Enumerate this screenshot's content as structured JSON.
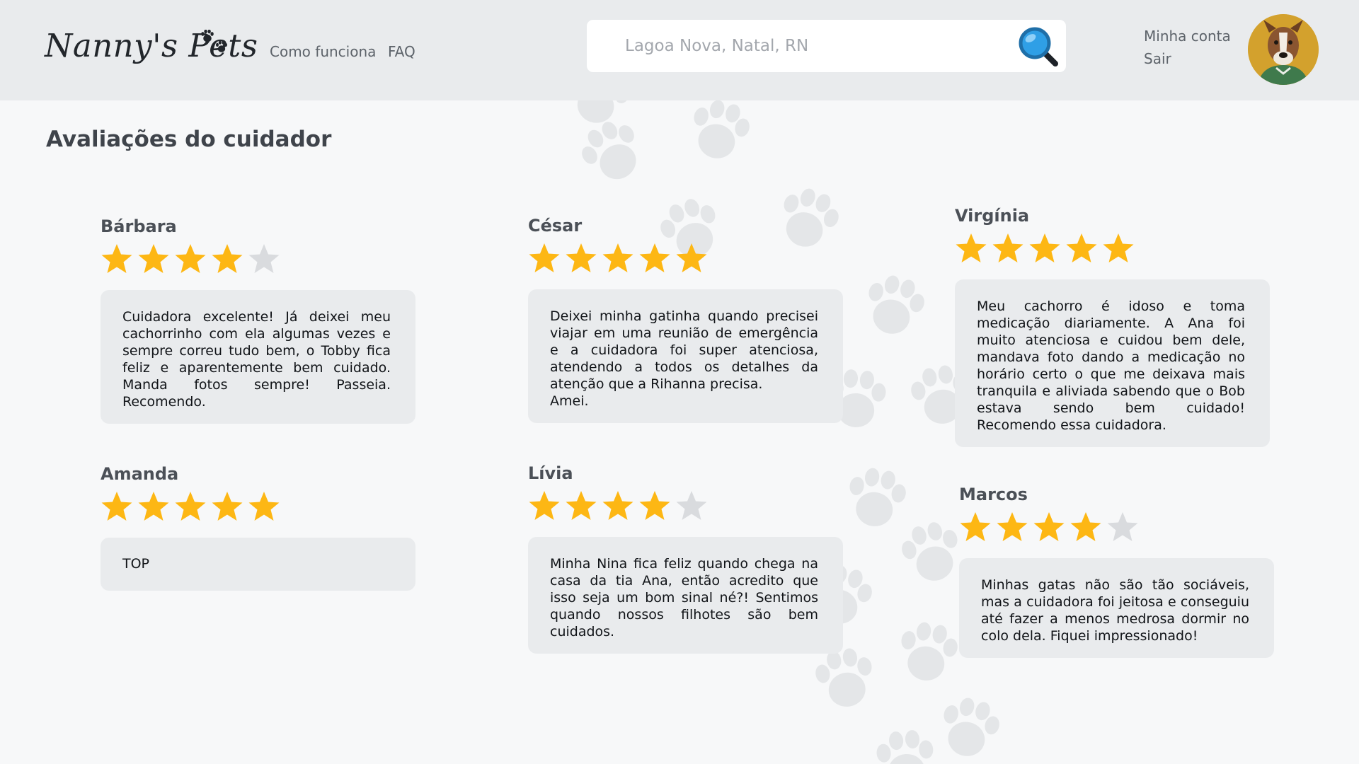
{
  "header": {
    "logo_text": "Nanny's Pets",
    "nav": {
      "how_it_works": "Como funciona",
      "faq": "FAQ"
    },
    "search": {
      "placeholder": "Lagoa Nova, Natal, RN",
      "icon": "magnifier-icon"
    },
    "account": {
      "my_account": "Minha conta",
      "logout": "Sair"
    }
  },
  "main": {
    "title": "Avaliações do cuidador",
    "reviews": [
      {
        "name": "Bárbara",
        "rating": 4,
        "text": "Cuidadora excelente! Já deixei meu cachorrinho com ela algumas vezes e sempre correu tudo bem, o Tobby fica feliz e aparentemente bem cuidado. Manda fotos sempre! Passeia. Recomendo."
      },
      {
        "name": "César",
        "rating": 5,
        "text": "Deixei minha gatinha quando precisei viajar em uma reunião de emergência e a cuidadora foi super atenciosa, atendendo a todos os detalhes da atenção que a Rihanna precisa.\nAmei."
      },
      {
        "name": "Virgínia",
        "rating": 5,
        "text": "Meu cachorro é idoso e toma medicação diariamente. A Ana foi muito atenciosa e cuidou bem dele, mandava foto dando a medicação no horário certo o que me deixava mais tranquila e aliviada sabendo que o Bob estava sendo bem cuidado! Recomendo essa cuidadora."
      },
      {
        "name": "Amanda",
        "rating": 5,
        "text": "TOP"
      },
      {
        "name": "Lívia",
        "rating": 4,
        "text": "Minha Nina fica feliz quando chega na casa da tia Ana, então acredito que isso seja um bom sinal né?! Sentimos quando nossos filhotes são bem cuidados."
      },
      {
        "name": "Marcos",
        "rating": 4,
        "text": "Minhas gatas não são tão sociáveis, mas a cuidadora foi jeitosa e conseguiu até fazer a menos medrosa dormir no colo dela. Fiquei impressionado!"
      }
    ]
  },
  "colors": {
    "header_bg": "#e9ebed",
    "page_bg": "#f7f8f9",
    "card_bg": "#e9ebed",
    "star_filled": "#fdb714",
    "star_empty": "#d9dbde",
    "paw_watermark": "#e4e6e8",
    "search_icon": "#2f9fe6"
  }
}
